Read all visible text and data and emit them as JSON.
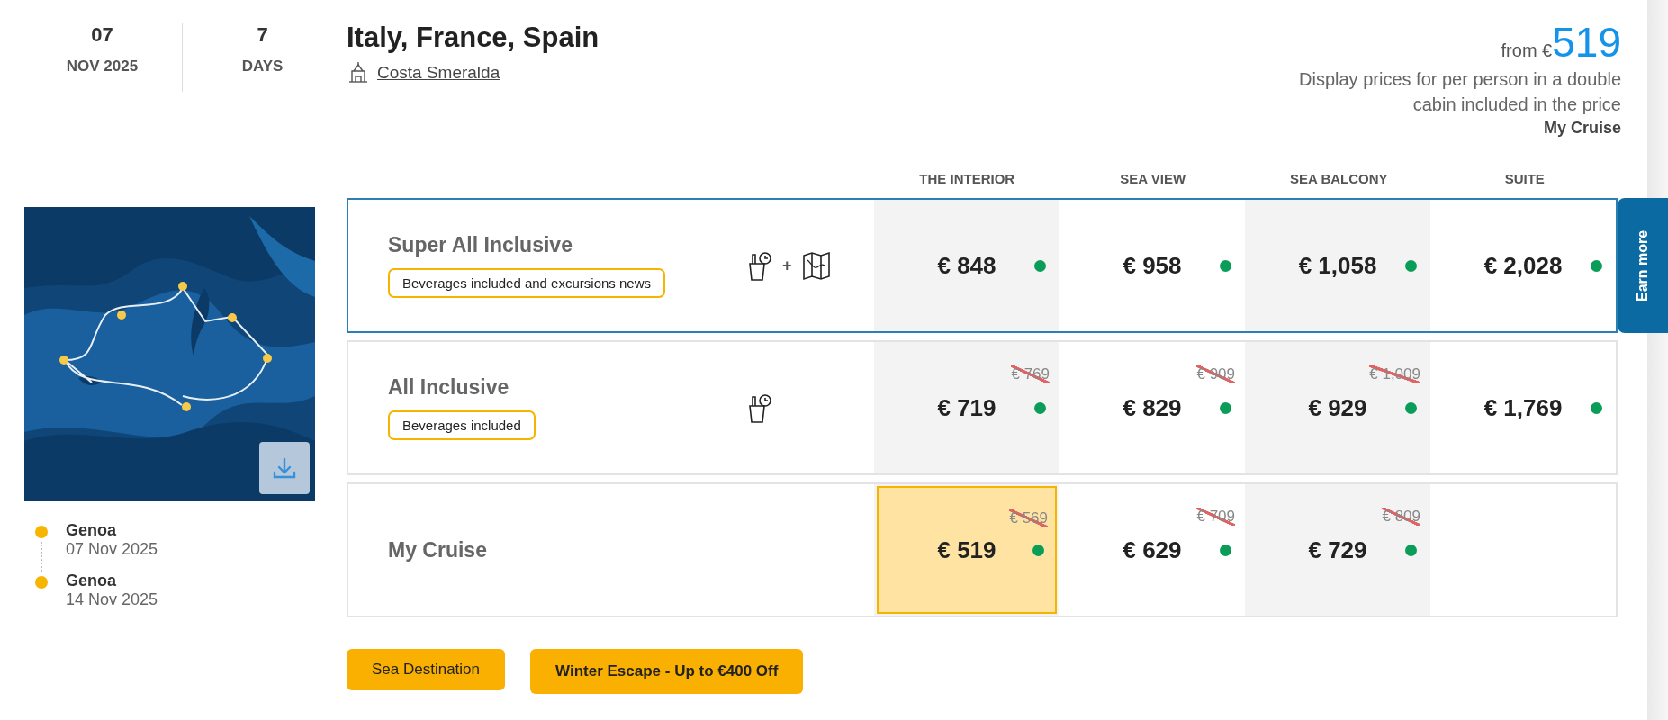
{
  "departure": {
    "day": "07",
    "month_year": "NOV 2025"
  },
  "duration": {
    "value": "7",
    "unit": "DAYS"
  },
  "title": "Italy, France, Spain",
  "ship": "Costa Smeralda",
  "price": {
    "prefix": "from €",
    "amount": "519",
    "note": "Display prices for per person in a double cabin included in the price",
    "fare": "My Cruise"
  },
  "itinerary": [
    {
      "port": "Genoa",
      "date": "07 Nov 2025"
    },
    {
      "port": "Genoa",
      "date": "14 Nov 2025"
    }
  ],
  "columns": [
    {
      "label": "THE INTERIOR",
      "shaded": true
    },
    {
      "label": "SEA VIEW",
      "shaded": false
    },
    {
      "label": "SEA BALCONY",
      "shaded": true
    },
    {
      "label": "SUITE",
      "shaded": false
    }
  ],
  "fares": [
    {
      "name": "Super All Inclusive",
      "badge": "Beverages included and excursions news",
      "inclusions": [
        {
          "kind": "drinks"
        },
        {
          "kind": "map"
        }
      ],
      "joiner": "+",
      "highlighted": true,
      "side_tab": "Earn more",
      "prices": [
        {
          "price": "€ 848",
          "available": true,
          "selected": false
        },
        {
          "price": "€ 958",
          "available": true,
          "selected": false
        },
        {
          "price": "€ 1,058",
          "available": true,
          "selected": false
        },
        {
          "price": "€ 2,028",
          "available": true,
          "selected": false
        }
      ]
    },
    {
      "name": "All Inclusive",
      "badge": "Beverages included",
      "inclusions": [
        {
          "kind": "drinks"
        }
      ],
      "highlighted": false,
      "prices": [
        {
          "old": "€ 769",
          "price": "€ 719",
          "available": true,
          "selected": false
        },
        {
          "old": "€ 909",
          "price": "€ 829",
          "available": true,
          "selected": false
        },
        {
          "old": "€ 1,009",
          "price": "€ 929",
          "available": true,
          "selected": false
        },
        {
          "price": "€ 1,769",
          "available": true,
          "selected": false
        }
      ]
    },
    {
      "name": "My Cruise",
      "highlighted": false,
      "prices": [
        {
          "old": "€ 569",
          "price": "€ 519",
          "available": true,
          "selected": true
        },
        {
          "old": "€ 709",
          "price": "€ 629",
          "available": true,
          "selected": false
        },
        {
          "old": "€ 809",
          "price": "€ 729",
          "available": true,
          "selected": false
        }
      ]
    }
  ],
  "tags": [
    {
      "label": "Sea Destination",
      "bold": false
    },
    {
      "label": "Winter Escape - Up to €400 Off",
      "bold": true
    }
  ]
}
